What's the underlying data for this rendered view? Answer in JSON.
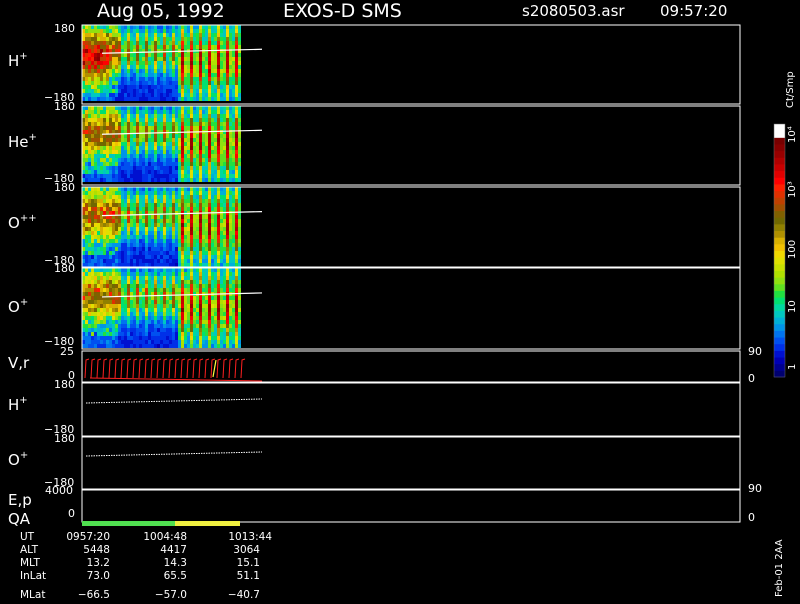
{
  "header": {
    "date": "Aug 05, 1992",
    "mission": "EXOS-D SMS",
    "filename": "s2080503.asr",
    "time": "09:57:20"
  },
  "colorbar": {
    "unit": "Ct/Smp",
    "tick_labels": [
      "1",
      "10",
      "100",
      "10³",
      "10⁴"
    ],
    "colors": [
      "#000070",
      "#000090",
      "#0000b4",
      "#0010d0",
      "#0030e8",
      "#0050f0",
      "#0074f0",
      "#0094e8",
      "#00b0d8",
      "#00c8c0",
      "#00d8a0",
      "#00e070",
      "#20e040",
      "#60e020",
      "#90e010",
      "#b0e000",
      "#c8e000",
      "#e0e000",
      "#f0d800",
      "#f0c000",
      "#d8b000",
      "#b09000",
      "#908000",
      "#706800",
      "#806000",
      "#a05000",
      "#c04000",
      "#e03000",
      "#ff2000",
      "#ff0000",
      "#e00000",
      "#c80000",
      "#b00000",
      "#980000",
      "#880000",
      "#780000",
      "#ffffff",
      "#ffffff"
    ]
  },
  "panels": [
    {
      "label_base": "H",
      "label_sup": "+",
      "y_top": "180",
      "y_bottom": "−180"
    },
    {
      "label_base": "He",
      "label_sup": "+",
      "y_top": "180",
      "y_bottom": "−180"
    },
    {
      "label_base": "O",
      "label_sup": "++",
      "y_top": "180",
      "y_bottom": "−180"
    },
    {
      "label_base": "O",
      "label_sup": "+",
      "y_top": "180",
      "y_bottom": "−180"
    }
  ],
  "vr_panel": {
    "label": "V,r",
    "y_top": "25",
    "y_bottom": "0",
    "r_top": "90",
    "r_bottom": "0"
  },
  "angle_panels": [
    {
      "label_base": "H",
      "label_sup": "+",
      "y_top": "180",
      "y_bottom": "−180"
    },
    {
      "label_base": "O",
      "label_sup": "+",
      "y_top": "180",
      "y_bottom": "−180"
    }
  ],
  "ep_panel": {
    "label": "E,p",
    "y_top": "4000",
    "y_bottom": "0",
    "r_top": "90",
    "r_bottom": "0"
  },
  "qa_panel": {
    "label": "QA",
    "colors": [
      "#50e050",
      "#f0f040"
    ]
  },
  "ephemeris": {
    "row_labels": [
      "UT",
      "ALT",
      "MLT",
      "InLat",
      "MLat"
    ],
    "columns": [
      [
        "0957:20",
        "5448",
        "13.2",
        "73.0",
        "−66.5"
      ],
      [
        "1004:48",
        "4417",
        "14.3",
        "65.5",
        "−57.0"
      ],
      [
        "1013:44",
        "3064",
        "15.1",
        "51.1",
        "−40.7"
      ]
    ]
  },
  "side_label": "Feb-01 2AA",
  "chart_data": {
    "type": "heatmap",
    "title": "Aug 05, 1992   EXOS-D SMS",
    "ion_species": [
      "H+",
      "He+",
      "O++",
      "O+"
    ],
    "ylim_deg": [
      -180,
      180
    ],
    "ut_ticks": [
      "0957:20",
      "1004:48",
      "1013:44"
    ],
    "colorbar_scale": "log",
    "colorbar_range": [
      1,
      10000
    ],
    "vr_ylim": [
      0,
      25
    ],
    "ep_ylim": [
      0,
      4000
    ],
    "right_axis_range": [
      0,
      90
    ]
  }
}
